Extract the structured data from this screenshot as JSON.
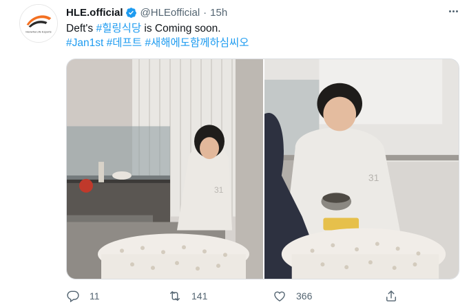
{
  "tweet": {
    "author": {
      "display_name": "HLE.official",
      "handle": "@HLEofficial",
      "avatar_logo_text": "Hanwha Life Esports",
      "verified": true
    },
    "separator": "·",
    "time": "15h",
    "text_line1": {
      "prefix": "Deft's ",
      "hashtag": "#힐링식당",
      "suffix": " is Coming soon."
    },
    "hashtags_line2": [
      "#Jan1st",
      "#데프트",
      "#새해에도함께하심씨오"
    ],
    "media": {
      "photo_count": 2,
      "hoodie_print": "31"
    },
    "actions": {
      "replies": "11",
      "retweets": "141",
      "likes": "366"
    },
    "colors": {
      "accent": "#1d9bf0",
      "secondary_text": "#536471",
      "brand_orange": "#f37021"
    },
    "icons": [
      "verified-badge-icon",
      "more-icon",
      "reply-icon",
      "retweet-icon",
      "like-icon",
      "share-icon"
    ]
  }
}
